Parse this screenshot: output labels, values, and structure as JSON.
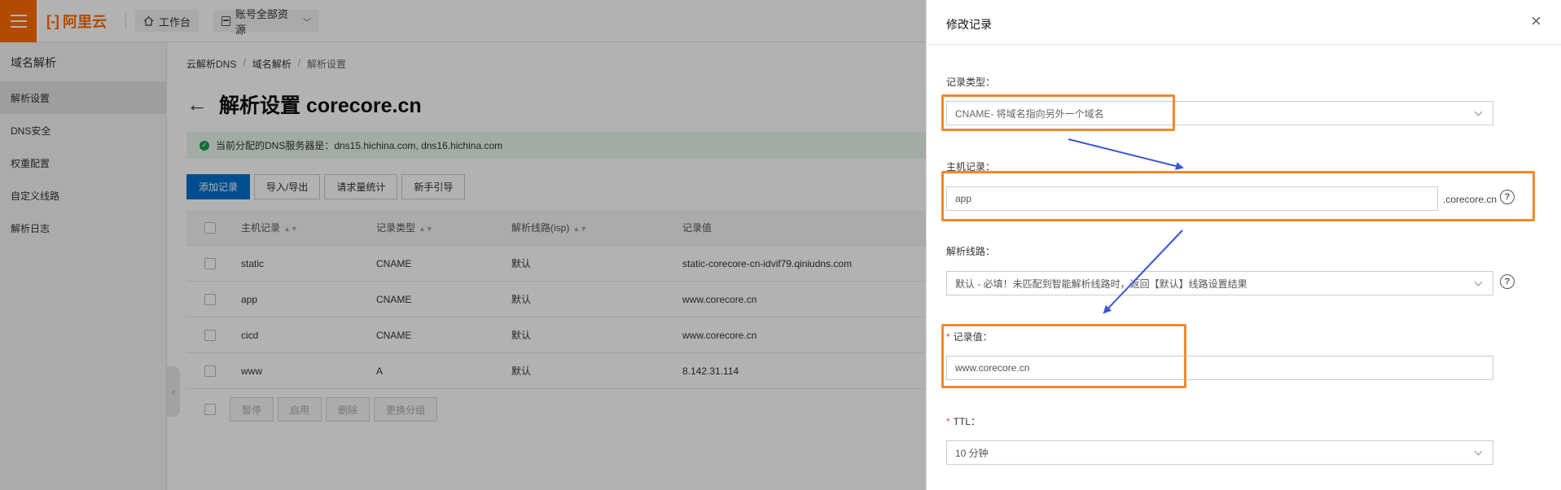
{
  "topbar": {
    "logo_text": "阿里云",
    "workbench_label": "工作台",
    "resources_label": "账号全部资源"
  },
  "sidebar": {
    "title": "域名解析",
    "items": [
      {
        "label": "解析设置",
        "active": true
      },
      {
        "label": "DNS安全",
        "active": false
      },
      {
        "label": "权重配置",
        "active": false
      },
      {
        "label": "自定义线路",
        "active": false
      },
      {
        "label": "解析日志",
        "active": false
      }
    ]
  },
  "breadcrumb": [
    "云解析DNS",
    "域名解析",
    "解析设置"
  ],
  "page": {
    "title": "解析设置 corecore.cn",
    "notice": "当前分配的DNS服务器是：dns15.hichina.com, dns16.hichina.com"
  },
  "actions": [
    "添加记录",
    "导入/导出",
    "请求量统计",
    "新手引导"
  ],
  "table": {
    "columns": [
      "主机记录",
      "记录类型",
      "解析线路(isp)",
      "记录值"
    ],
    "rows": [
      [
        "static",
        "CNAME",
        "默认",
        "static-corecore-cn-idvif79.qiniudns.com"
      ],
      [
        "app",
        "CNAME",
        "默认",
        "www.corecore.cn"
      ],
      [
        "cicd",
        "CNAME",
        "默认",
        "www.corecore.cn"
      ],
      [
        "www",
        "A",
        "默认",
        "8.142.31.114"
      ]
    ]
  },
  "bulk_actions": [
    "暂停",
    "启用",
    "删除",
    "更换分组"
  ],
  "drawer": {
    "title": "修改记录",
    "record_type": {
      "label": "记录类型：",
      "value": "CNAME- 将域名指向另外一个域名"
    },
    "host": {
      "label": "主机记录：",
      "value": "app",
      "suffix": ".corecore.cn"
    },
    "line": {
      "label": "解析线路：",
      "value": "默认 - 必填！未匹配到智能解析线路时，返回【默认】线路设置结果"
    },
    "record_value": {
      "label": "记录值：",
      "value": "www.corecore.cn"
    },
    "ttl": {
      "label": "TTL：",
      "value": "10 分钟"
    }
  },
  "colors": {
    "brand": "#ff6a00",
    "primary": "#0070cc",
    "highlight": "#f08a2c",
    "arrow": "#3a55d9"
  }
}
